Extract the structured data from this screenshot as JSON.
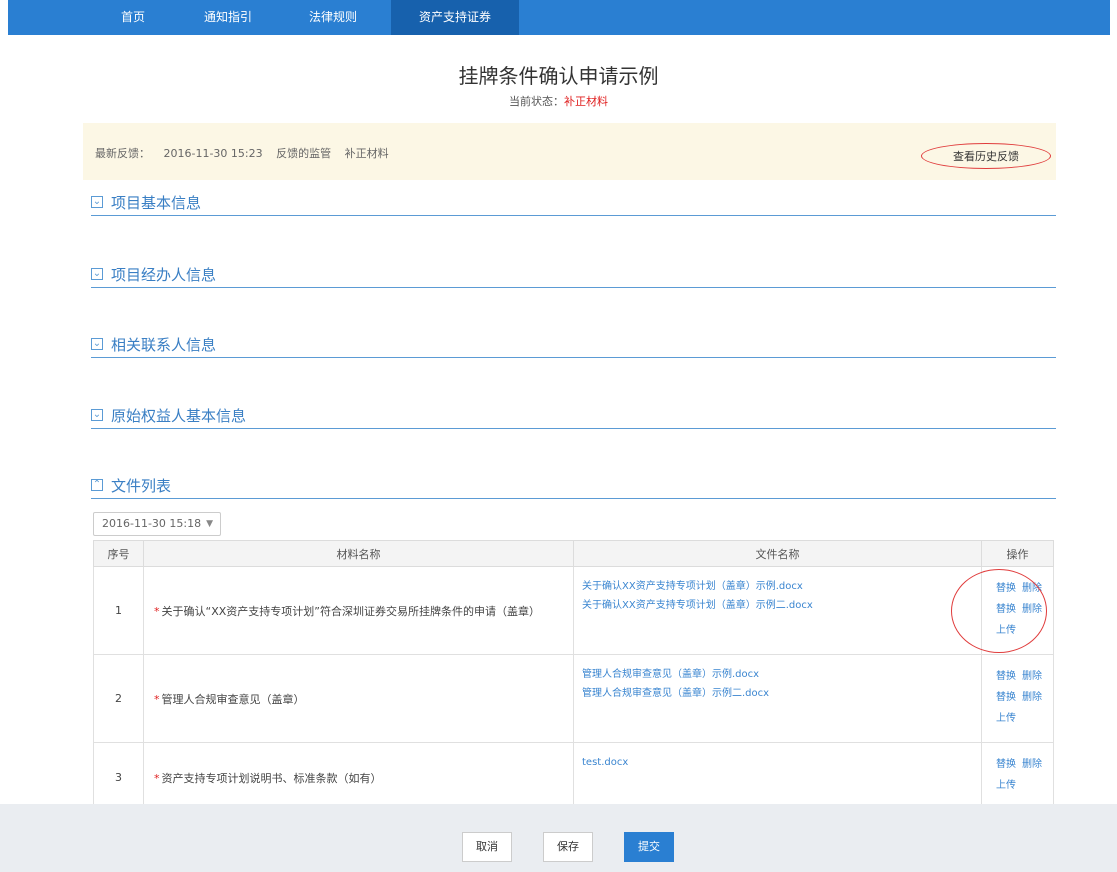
{
  "nav": {
    "items": [
      {
        "label": "首页"
      },
      {
        "label": "通知指引"
      },
      {
        "label": "法律规则"
      },
      {
        "label": "资产支持证券"
      }
    ]
  },
  "header": {
    "title": "挂牌条件确认申请示例",
    "status_label": "当前状态：",
    "status_value": "补正材料"
  },
  "banner": {
    "label": "最新反馈：",
    "time": "2016-11-30 15:23",
    "reviewer": "反馈的监管",
    "action": "补正材料",
    "history_button": "查看历史反馈"
  },
  "sections": [
    {
      "title": "项目基本信息",
      "icon": "collapse-icon"
    },
    {
      "title": "项目经办人信息",
      "icon": "collapse-icon"
    },
    {
      "title": "相关联系人信息",
      "icon": "collapse-icon"
    },
    {
      "title": "原始权益人基本信息",
      "icon": "collapse-icon"
    },
    {
      "title": "文件列表",
      "icon": "expand-icon"
    }
  ],
  "version_select": {
    "value": "2016-11-30 15:18"
  },
  "table": {
    "headers": [
      "序号",
      "材料名称",
      "文件名称",
      "操作"
    ],
    "rows": [
      {
        "seq": "1",
        "material": "关于确认“XX资产支持专项计划”符合深圳证券交易所挂牌条件的申请（盖章）",
        "files": [
          "关于确认XX资产支持专项计划（盖章）示例.docx",
          "关于确认XX资产支持专项计划（盖章）示例二.docx"
        ]
      },
      {
        "seq": "2",
        "material": "管理人合规审查意见（盖章）",
        "files": [
          "管理人合规审查意见（盖章）示例.docx",
          "管理人合规审查意见（盖章）示例二.docx"
        ]
      },
      {
        "seq": "3",
        "material": "资产支持专项计划说明书、标准条款（如有）",
        "files": [
          "test.docx"
        ]
      }
    ],
    "ops": {
      "replace": "替换",
      "delete": "删除",
      "upload": "上传"
    }
  },
  "footer": {
    "cancel": "取消",
    "save": "保存",
    "submit": "提交"
  },
  "colors": {
    "nav_bg": "#2a7fd2",
    "nav_active": "#1761ad",
    "accent": "#3a7fc4",
    "status_red": "#e02020",
    "banner_bg": "#fcf7e5"
  }
}
